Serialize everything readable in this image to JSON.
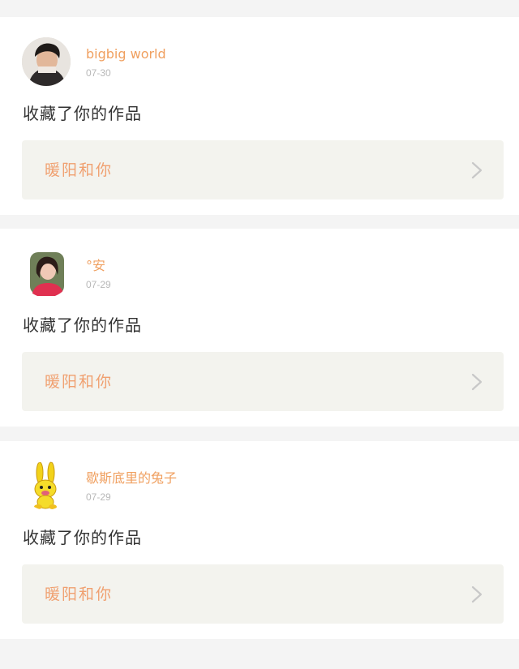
{
  "notifications": [
    {
      "user": "bigbig world",
      "date": "07-30",
      "action": "收藏了你的作品",
      "work_title": "暖阳和你",
      "avatar": "avatar-young-man-photo"
    },
    {
      "user": "°安",
      "date": "07-29",
      "action": "收藏了你的作品",
      "work_title": "暖阳和你",
      "avatar": "avatar-girl-photo"
    },
    {
      "user": "歇斯底里的兔子",
      "date": "07-29",
      "action": "收藏了你的作品",
      "work_title": "暖阳和你",
      "avatar": "avatar-yellow-bunny-cartoon"
    }
  ],
  "colors": {
    "background": "#f4f4f4",
    "card": "#ffffff",
    "username": "#f0a060",
    "date": "#b8b8b8",
    "action_text": "#333333",
    "work_box": "#f3f3ee",
    "work_title": "#f0a070",
    "chevron": "#c8c8c8"
  },
  "icons": {
    "chevron": "chevron-right-icon"
  }
}
